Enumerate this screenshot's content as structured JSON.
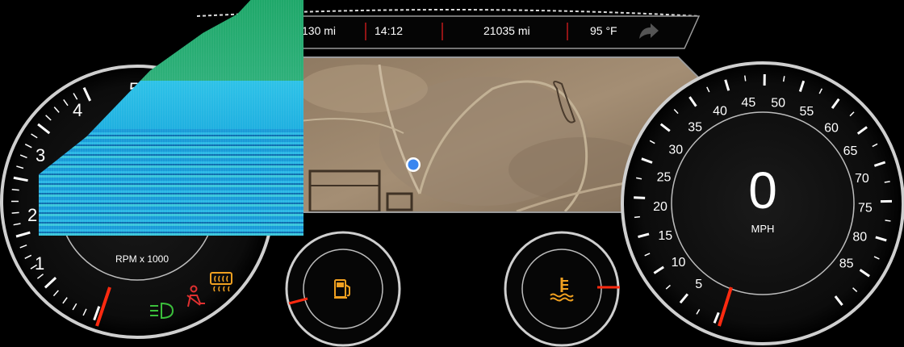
{
  "top_bar": {
    "range": "130 mi",
    "time": "14:12",
    "odometer": "21035 mi",
    "temperature": "95 °F"
  },
  "tachometer": {
    "unit_label": "RPM x 1000",
    "ticks_visible": [
      "1",
      "2",
      "3",
      "4",
      "5"
    ],
    "value_rpm_x1000": 0
  },
  "speedometer": {
    "value": "0",
    "unit": "MPH",
    "ticks": [
      "5",
      "10",
      "15",
      "20",
      "25",
      "30",
      "35",
      "40",
      "45",
      "50",
      "55",
      "60",
      "65",
      "70",
      "75",
      "80",
      "85"
    ]
  },
  "indicators": {
    "headlight": "headlight-icon",
    "seatbelt": "seatbelt-warning-icon",
    "rear_defrost": "rear-defrost-icon",
    "fuel": "fuel-pump-icon",
    "coolant": "coolant-temperature-icon"
  },
  "gauges": {
    "fuel_level": 0.1,
    "coolant_level": 0.5
  },
  "map": {
    "marker": "current-location-marker"
  },
  "colors": {
    "needle": "#ff2a10",
    "indicator_green": "#3bbf3b",
    "indicator_red": "#e03030",
    "indicator_orange": "#f0a020",
    "location_blue": "#3a86f0",
    "bezel": "#c8c8c8"
  }
}
